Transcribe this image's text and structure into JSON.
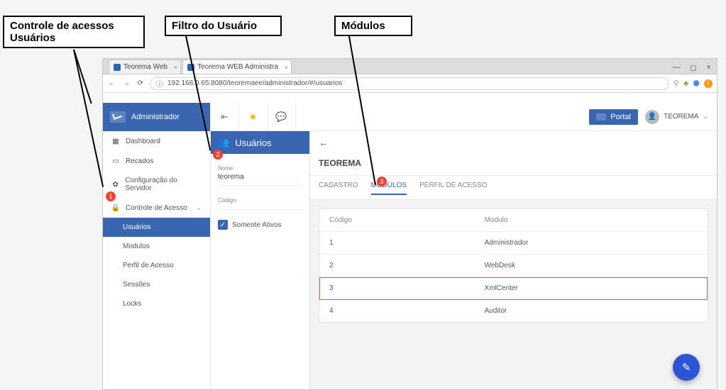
{
  "callouts": {
    "c1_line1": "Controle de acessos",
    "c1_line2": "Usuários",
    "c2": "Filtro do Usuário",
    "c3": "Módulos"
  },
  "browser": {
    "tabs": [
      {
        "label": "Teorema Web"
      },
      {
        "label": "Teorema WEB Administra"
      }
    ],
    "url": "192.168.0.65:8080/teoremaee/administrador/#/usuarios"
  },
  "sidebar": {
    "brand": "Administrador",
    "items": [
      {
        "icon": "▦",
        "label": "Dashboard"
      },
      {
        "icon": "▭",
        "label": "Recados"
      },
      {
        "icon": "✿",
        "label": "Configuração do Servidor"
      }
    ],
    "access": {
      "icon": "🔒",
      "label": "Controle de Acesso",
      "children": [
        "Usuários",
        "Modulos",
        "Perfil de Acesso",
        "Sessões",
        "Locks"
      ]
    }
  },
  "topbar": {
    "portal": "Portal",
    "user": "TEOREMA"
  },
  "filter": {
    "title": "Usuários",
    "nome_label": "Nome",
    "nome_value": "teorema",
    "codigo_label": "Código",
    "somente_ativos": "Somente Ativos"
  },
  "detail": {
    "heading": "TEOREMA",
    "tabs": [
      "CADASTRO",
      "MÓDULOS",
      "PERFIL DE ACESSO"
    ],
    "table": {
      "col_codigo": "Código",
      "col_modulo": "Modulo",
      "rows": [
        {
          "codigo": "1",
          "modulo": "Administrador"
        },
        {
          "codigo": "2",
          "modulo": "WebDesk"
        },
        {
          "codigo": "3",
          "modulo": "XmlCenter"
        },
        {
          "codigo": "4",
          "modulo": "Auditor"
        }
      ]
    }
  },
  "badges": {
    "b1": "1",
    "b2": "2",
    "b3": "3"
  }
}
